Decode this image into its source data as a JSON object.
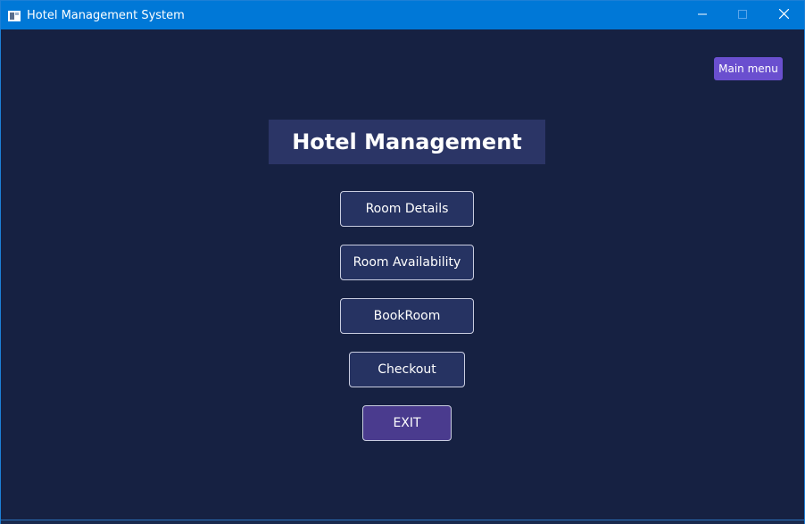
{
  "window": {
    "title": "Hotel Management System"
  },
  "header": {
    "main_menu_label": "Main menu"
  },
  "main": {
    "title": "Hotel Management",
    "buttons": {
      "room_details": "Room Details",
      "room_availability": "Room Availability",
      "book_room": "BookRoom",
      "checkout": "Checkout",
      "exit": "EXIT"
    }
  },
  "colors": {
    "titlebar": "#0078d7",
    "background": "#162142",
    "title_panel": "#2b3566",
    "button": "#263362",
    "exit_button": "#4a3b8e",
    "main_menu_button": "#6a4fcf"
  },
  "icons": {
    "app": "app-window-icon",
    "minimize": "minimize-icon",
    "maximize": "maximize-icon",
    "close": "close-icon"
  }
}
